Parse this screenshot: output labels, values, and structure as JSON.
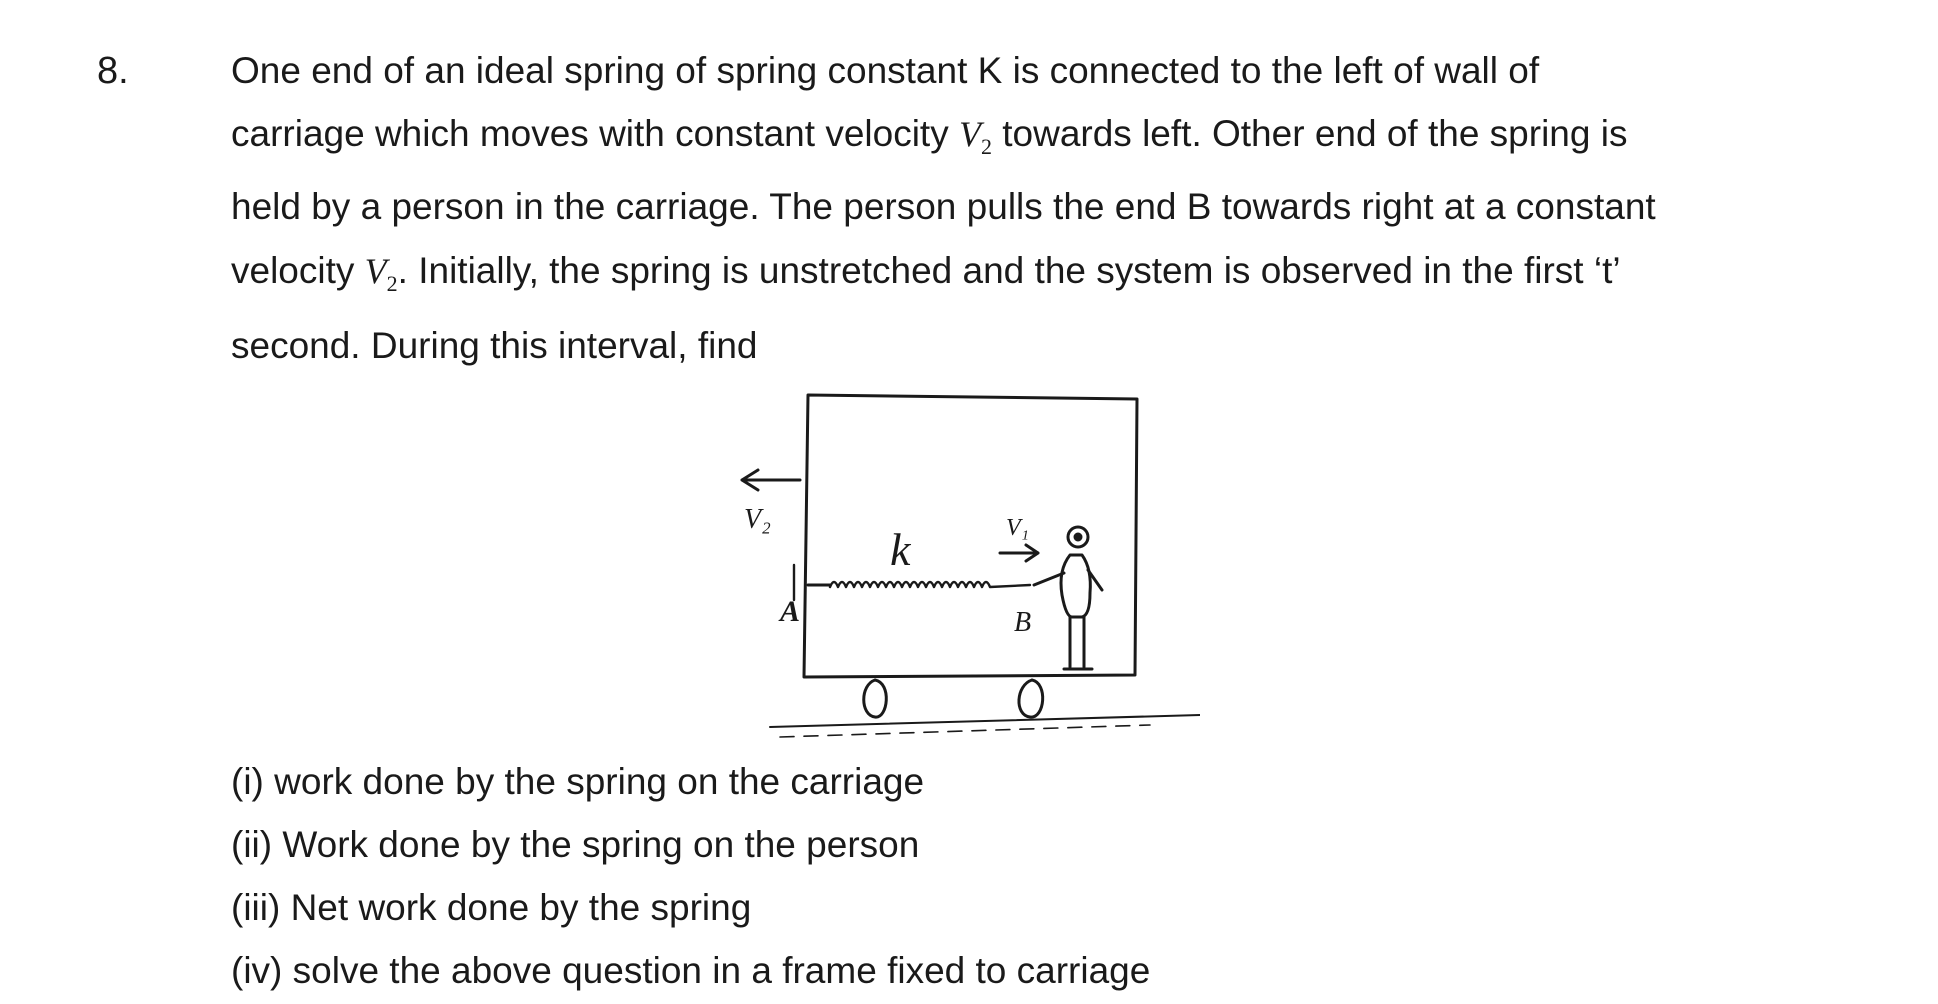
{
  "question": {
    "number": "8.",
    "lines": [
      {
        "text": "One end of an ideal spring of spring constant K is connected to the left of wall of"
      },
      {
        "pre": "carriage which moves with constant velocity ",
        "var": "V",
        "sub": "2",
        "post": " towards left. Other end of the spring is"
      },
      {
        "text": "held by a person in the carriage. The person pulls the end B towards right at a constant"
      },
      {
        "pre": "velocity ",
        "var": "V",
        "sub": "2",
        "post": ". Initially, the spring is unstretched and the system is observed in the first ‘t’"
      },
      {
        "text": "second. During this interval, find"
      }
    ],
    "parts": [
      "(i) work done by the spring on the carriage",
      "(ii) Work done by the spring on the person",
      "(iii) Net work done by the spring",
      "(iv) solve the above question in a frame fixed to carriage"
    ]
  },
  "figure": {
    "label_velocity_carriage": "V₂",
    "label_velocity_person": "V₁",
    "label_spring": "k",
    "label_end_A": "A",
    "label_end_B": "B"
  }
}
